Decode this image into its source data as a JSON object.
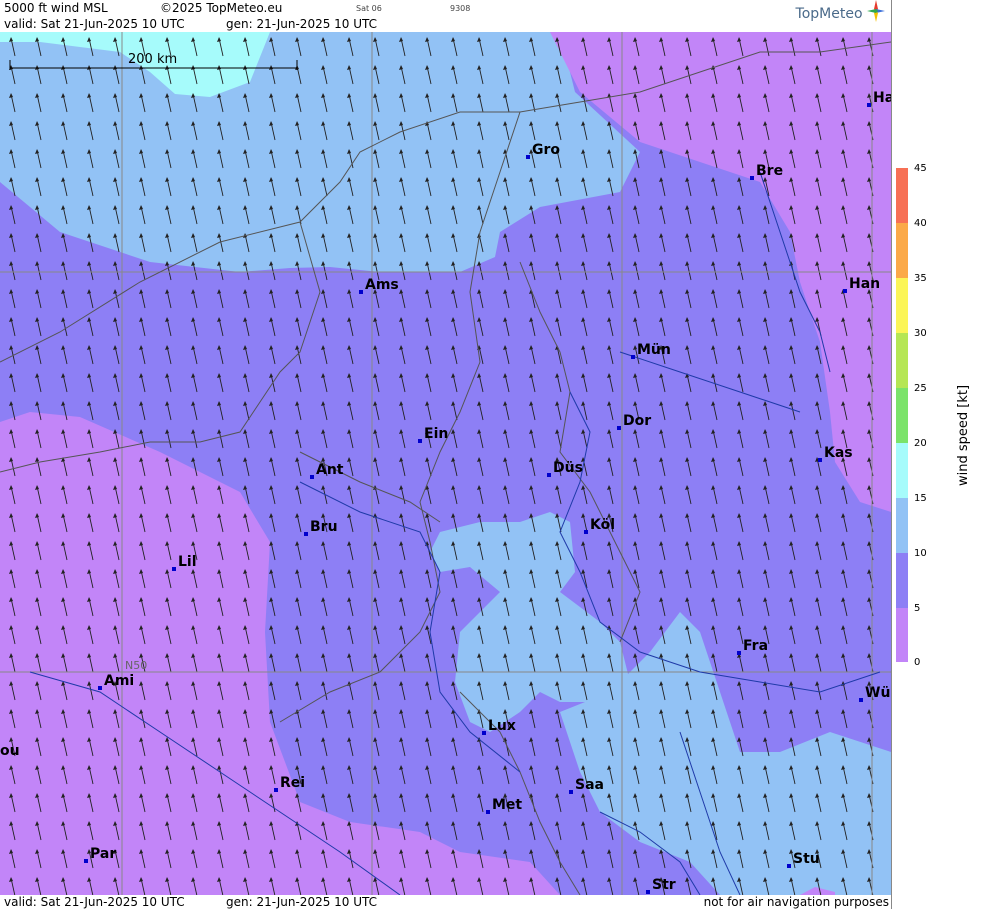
{
  "header": {
    "product": "5000 ft wind MSL",
    "copyright": "©2025 TopMeteo.eu",
    "valid": "valid:  Sat  21-Jun-2025  10 UTC",
    "generated": "gen: 21-Jun-2025 10 UTC",
    "day_code": "Sat 06",
    "run_code": "9308",
    "logo": "TopMeteo"
  },
  "map": {
    "scale_label": "200 km",
    "graticule_label": "N50",
    "cities": [
      {
        "name": "Gro"
      },
      {
        "name": "Bre"
      },
      {
        "name": "Ha"
      },
      {
        "name": "Ams"
      },
      {
        "name": "Han"
      },
      {
        "name": "Mün"
      },
      {
        "name": "Ein"
      },
      {
        "name": "Dor"
      },
      {
        "name": "Kas"
      },
      {
        "name": "Ant"
      },
      {
        "name": "Düs"
      },
      {
        "name": "Köl"
      },
      {
        "name": "Bru"
      },
      {
        "name": "Lil"
      },
      {
        "name": "Fra"
      },
      {
        "name": "Ami"
      },
      {
        "name": "Wü"
      },
      {
        "name": "Lux"
      },
      {
        "name": "ou"
      },
      {
        "name": "Rei"
      },
      {
        "name": "Saa"
      },
      {
        "name": "Met"
      },
      {
        "name": "Stu"
      },
      {
        "name": "Par"
      },
      {
        "name": "Str"
      }
    ]
  },
  "footer": {
    "valid": "valid:  Sat  21-Jun-2025  10 UTC",
    "generated": "gen: 21-Jun-2025 10 UTC",
    "disclaimer": "not for air navigation purposes"
  },
  "legend": {
    "unit_label": "wind  speed  [kt]",
    "ticks": [
      "45",
      "40",
      "35",
      "30",
      "25",
      "20",
      "15",
      "10",
      "5",
      "0"
    ],
    "colors": {
      "0-5": "#c285f8",
      "5-10": "#8d7ff5",
      "10-15": "#92c2f5",
      "15-20": "#a6fbfb",
      "20-25": "#7be36a",
      "25-30": "#b5e655",
      "30-35": "#fbf557",
      "35-40": "#fba948",
      "40-45": "#f77055"
    }
  }
}
